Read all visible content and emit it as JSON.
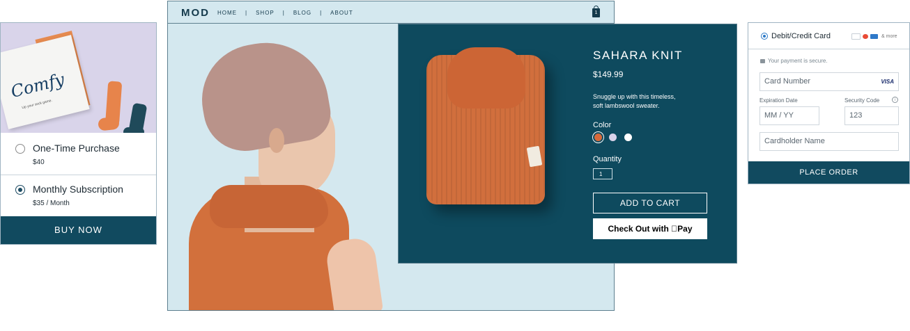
{
  "subscription": {
    "box_brand": "Comfy",
    "box_tagline": "Up your sock game.",
    "options": [
      {
        "label": "One-Time Purchase",
        "price": "$40",
        "selected": false
      },
      {
        "label": "Monthly Subscription",
        "price": "$35 / Month",
        "selected": true
      }
    ],
    "buy_label": "BUY NOW"
  },
  "store": {
    "brand": "MOD",
    "nav": [
      "HOME",
      "SHOP",
      "BLOG",
      "ABOUT"
    ],
    "nav_separator": "|",
    "cart_count": "1",
    "product": {
      "title": "SAHARA KNIT",
      "price": "$149.99",
      "description_lines": [
        "Snuggle up with this timeless,",
        "soft lambswool sweater."
      ],
      "color_label": "Color",
      "colors": [
        "#d8693a",
        "#d9d3ea",
        "#ffffff"
      ],
      "quantity_label": "Quantity",
      "quantity_value": "1",
      "add_to_cart_label": "ADD TO CART",
      "apple_pay_label": "Check Out with Pay"
    }
  },
  "payment": {
    "method_label": "Debit/Credit Card",
    "more_label": "& more",
    "secure_text": "Your payment is secure.",
    "card_number_placeholder": "Card Number",
    "card_brand": "VISA",
    "expiration_label": "Expiration Date",
    "expiration_placeholder": "MM / YY",
    "security_label": "Security Code",
    "security_value": "123",
    "cardholder_placeholder": "Cardholder Name",
    "place_order_label": "PLACE ORDER"
  },
  "colors": {
    "brand_teal": "#114a5f",
    "panel_teal": "#0e4a5e",
    "light_blue": "#d4e8ef",
    "sweater_orange": "#d16f3d"
  }
}
